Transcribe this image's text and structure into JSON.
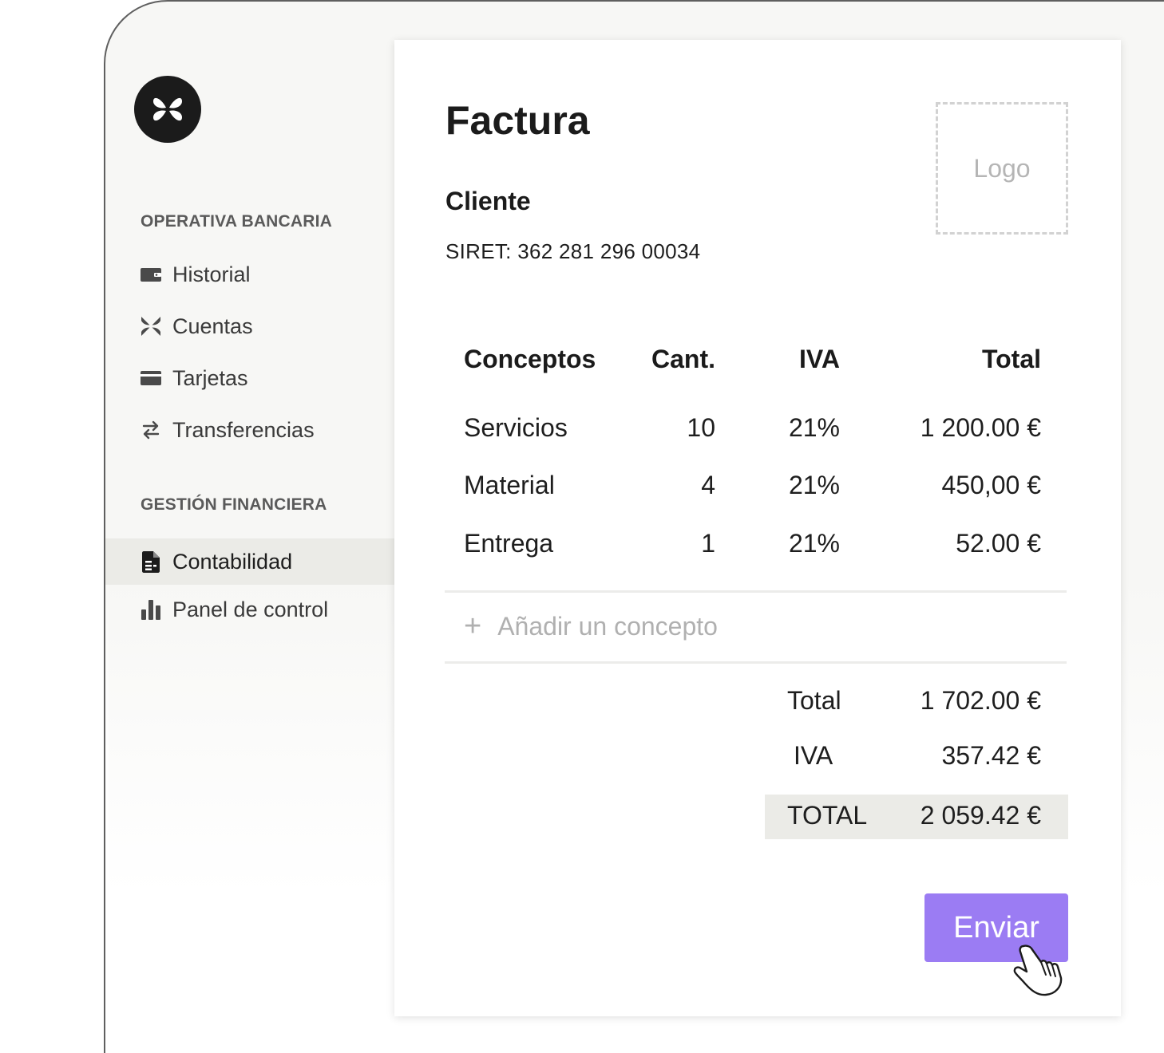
{
  "sidebar": {
    "sections": [
      {
        "label": "OPERATIVA BANCARIA",
        "items": [
          {
            "label": "Historial",
            "icon": "wallet-icon"
          },
          {
            "label": "Cuentas",
            "icon": "accounts-icon"
          },
          {
            "label": "Tarjetas",
            "icon": "card-icon"
          },
          {
            "label": "Transferencias",
            "icon": "transfer-arrows-icon"
          }
        ]
      },
      {
        "label": "GESTIÓN FINANCIERA",
        "items": [
          {
            "label": "Contabilidad",
            "icon": "document-icon",
            "active": true
          },
          {
            "label": "Panel de control",
            "icon": "bar-chart-icon"
          }
        ]
      }
    ]
  },
  "invoice": {
    "title": "Factura",
    "client_label": "Cliente",
    "siret": "SIRET: 362 281 296 00034",
    "logo_placeholder": "Logo",
    "columns": [
      "Conceptos",
      "Cant.",
      "IVA",
      "Total"
    ],
    "rows": [
      {
        "concept": "Servicios",
        "qty": "10",
        "vat": "21%",
        "total": "1 200.00 €"
      },
      {
        "concept": "Material",
        "qty": "4",
        "vat": "21%",
        "total": "450,00 €"
      },
      {
        "concept": "Entrega",
        "qty": "1",
        "vat": "21%",
        "total": "52.00 €"
      }
    ],
    "add_item_label": "Añadir un concepto",
    "summary": {
      "subtotal_label": "Total",
      "subtotal_value": "1 702.00 €",
      "vat_label": "IVA",
      "vat_value": "357.42 €",
      "grand_label": "TOTAL",
      "grand_value": "2 059.42 €"
    },
    "send_label": "Enviar"
  },
  "colors": {
    "accent": "#9b7cf3",
    "active_nav_bg": "#ebebe7",
    "brand_dark": "#1b1b1b"
  }
}
